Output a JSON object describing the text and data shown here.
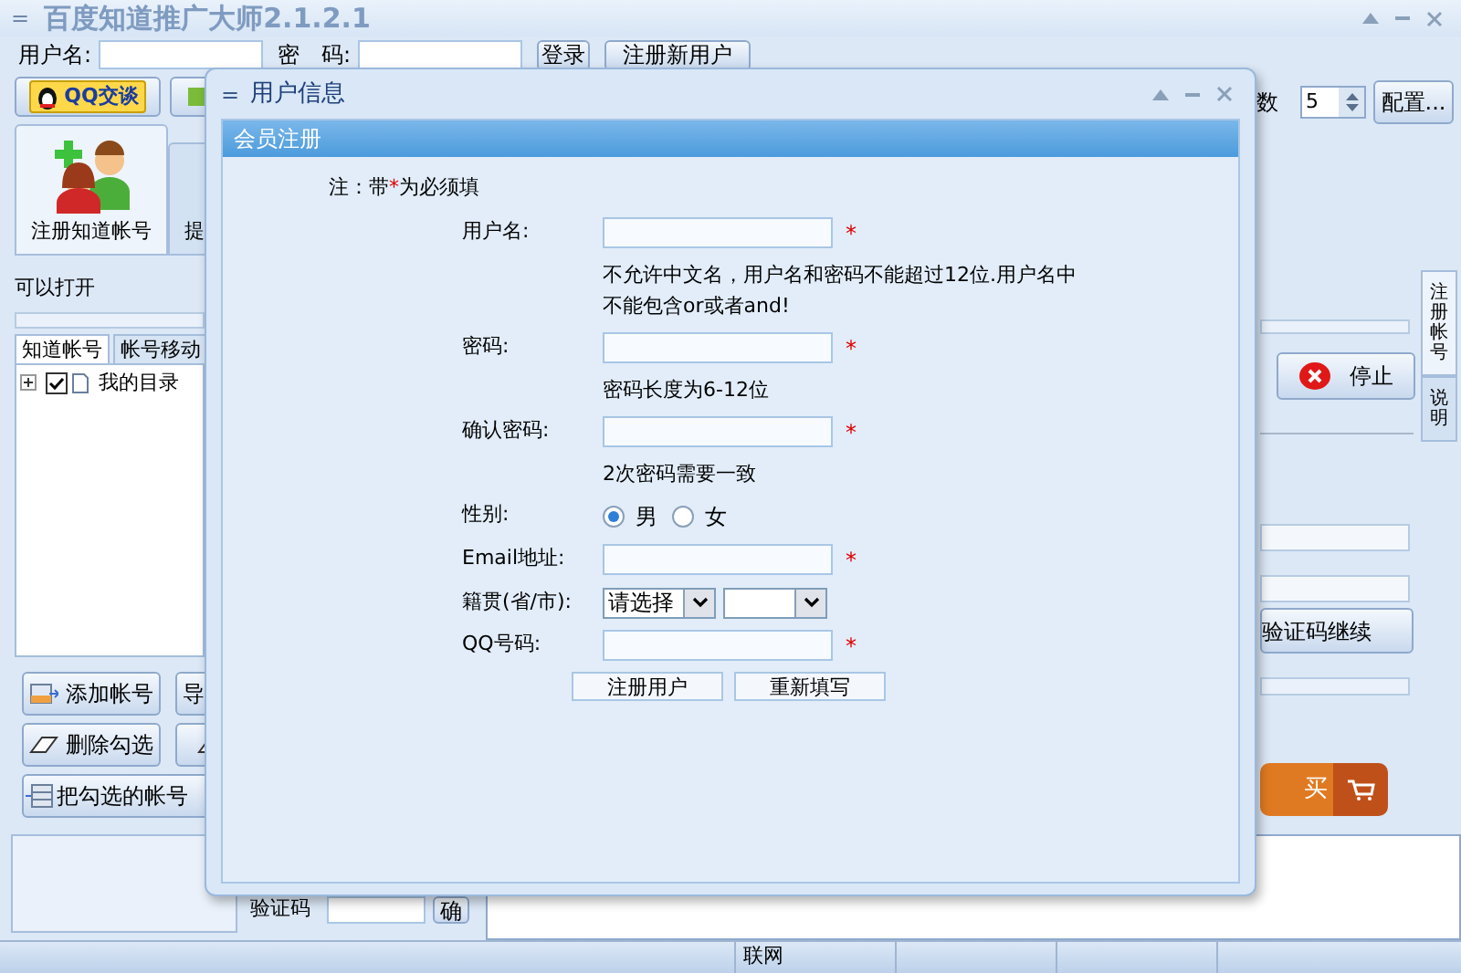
{
  "window": {
    "title": "百度知道推广大师2.1.2.1",
    "menu_glyph": "="
  },
  "login": {
    "username_label": "用户名:",
    "password_label": "密　码:",
    "login_button": "登录",
    "register_button": "注册新用户"
  },
  "toolbar": {
    "qq_button": "QQ交谈",
    "count_label": "数",
    "count_value": "5",
    "config_button": "配置..."
  },
  "big_tabs": [
    {
      "label": "注册知道帐号",
      "selected": true
    },
    {
      "label": "提",
      "selected": false
    }
  ],
  "status_text": "可以打开",
  "progress": [
    {
      "level": 0
    },
    {
      "level": 0
    },
    {
      "level": 0
    }
  ],
  "account_tabs": [
    {
      "label": "知道帐号",
      "selected": true
    },
    {
      "label": "帐号移动",
      "selected": false
    }
  ],
  "tree": [
    {
      "label": "我的目录",
      "checked": true,
      "expanded": false
    }
  ],
  "left_buttons": [
    {
      "label": "添加帐号",
      "kind": "add"
    },
    {
      "label": "导",
      "kind": "import"
    },
    {
      "label": "删除勾选",
      "kind": "erase"
    },
    {
      "kind": "erase"
    },
    {
      "label": "把勾选的帐号",
      "kind": "move"
    }
  ],
  "captcha": {
    "label": "验证码",
    "button": "确"
  },
  "right_panel": {
    "stop_button": "停止",
    "continue_button": "验证码继续",
    "buy_button": "买",
    "side_tabs": [
      {
        "label": "注册帐号",
        "selected": true
      },
      {
        "label": "说明",
        "selected": false
      }
    ]
  },
  "status_bar": {
    "text": "联网"
  },
  "dialog": {
    "title": "用户信息",
    "header": "会员注册",
    "note": {
      "before": "注：带",
      "mark": "*",
      "after": "为必须填"
    },
    "fields": [
      {
        "kind": "text",
        "label": "用户名:",
        "required": true,
        "hint": "不允许中文名，用户名和密码不能超过12位.用户名中不能包含or或者and!"
      },
      {
        "kind": "text",
        "label": "密码:",
        "required": true,
        "hint": "密码长度为6-12位"
      },
      {
        "kind": "text",
        "label": "确认密码:",
        "required": true,
        "hint": "2次密码需要一致"
      },
      {
        "kind": "radio",
        "label": "性别:",
        "options": [
          {
            "label": "男",
            "selected": true
          },
          {
            "label": "女",
            "selected": false
          }
        ]
      },
      {
        "kind": "text",
        "label": "Email地址:",
        "required": true
      },
      {
        "kind": "select",
        "label": "籍贯(省/市):",
        "value": "请选择"
      },
      {
        "kind": "text",
        "label": "QQ号码:",
        "required": true
      }
    ],
    "buttons": [
      "注册用户",
      "重新填写"
    ]
  }
}
